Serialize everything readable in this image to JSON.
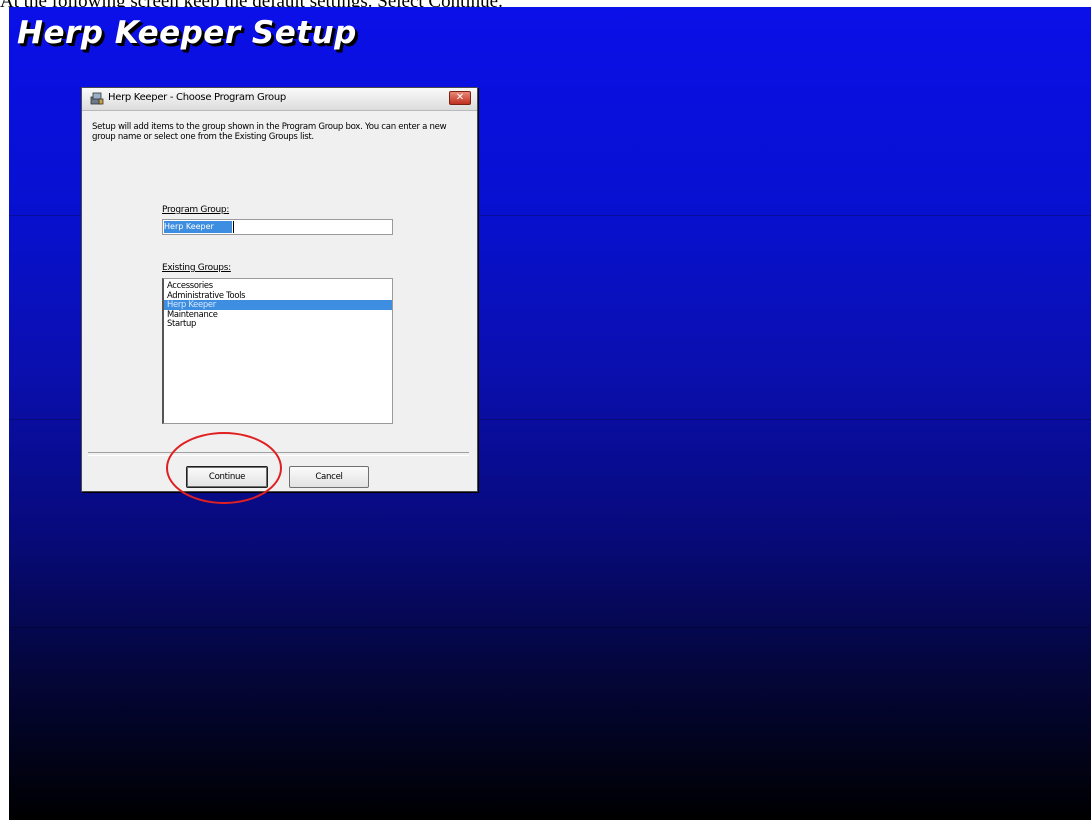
{
  "caption": "At the following screen keep the default settings. Select Continue.",
  "installer": {
    "title": "Herp Keeper Setup"
  },
  "dialog": {
    "title": "Herp Keeper - Choose Program Group",
    "close_label": "✕",
    "intro_text": "Setup will add items to the group shown in the Program Group box. You can enter a new group name or select one from the Existing Groups list.",
    "program_group_label": "Program Group:",
    "program_group_value": "Herp Keeper",
    "existing_groups_label": "Existing Groups:",
    "existing_groups": [
      "Accessories",
      "Administrative Tools",
      "Herp Keeper",
      "Maintenance",
      "Startup"
    ],
    "selected_group": "Herp Keeper",
    "continue_label": "Continue",
    "cancel_label": "Cancel"
  },
  "annotation": {
    "highlight_color": "#e02020",
    "highlight_target": "Continue"
  },
  "colors": {
    "gradient_top": "#0a10e8",
    "gradient_bottom": "#000000",
    "selection": "#3d8ee0"
  }
}
